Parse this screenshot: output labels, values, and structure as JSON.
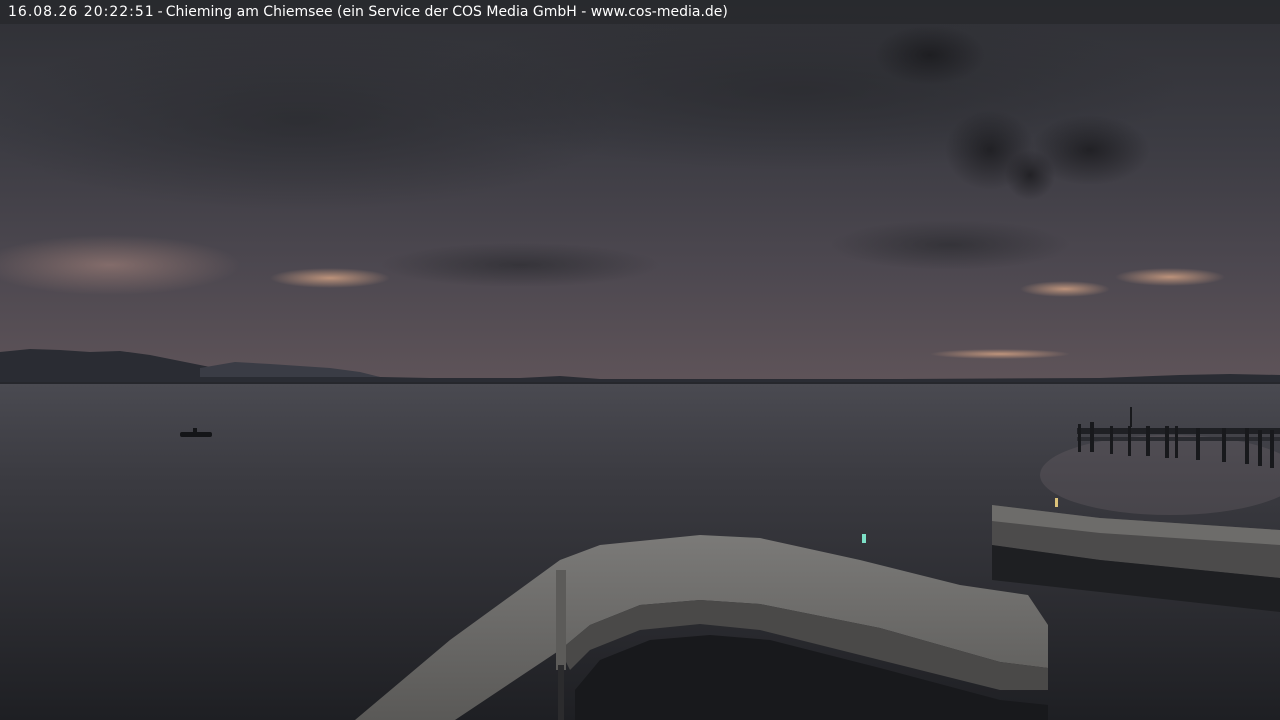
{
  "webcam": {
    "timestamp": "16.08.26 20:22:51",
    "separator": "-",
    "title": "Chieming am Chiemsee (ein Service der COS Media GmbH - www.cos-media.de)"
  }
}
